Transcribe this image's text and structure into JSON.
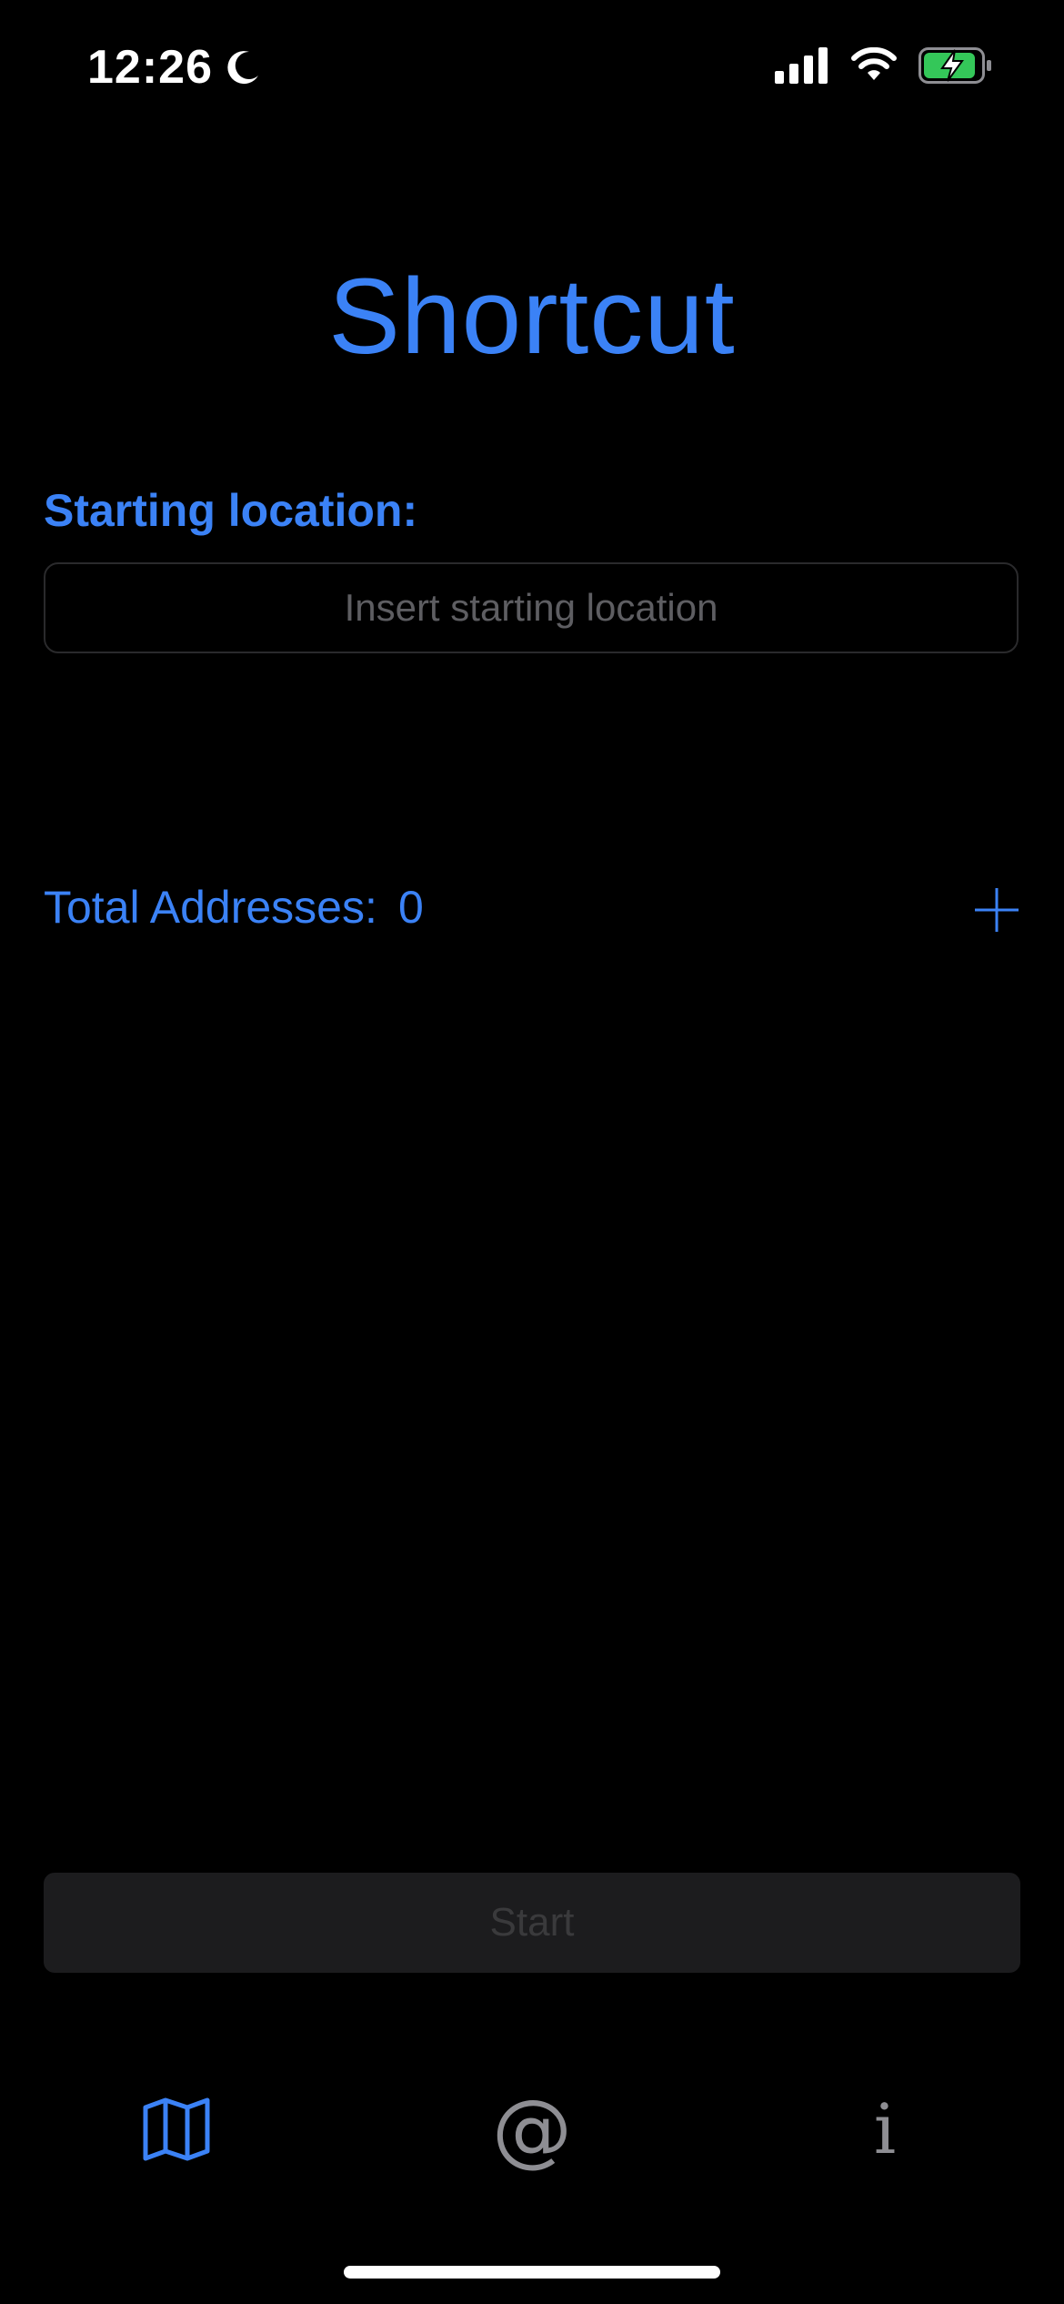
{
  "status_bar": {
    "time": "12:26",
    "icons": [
      "moon-icon",
      "cellular-signal-icon",
      "wifi-icon",
      "battery-charging-icon"
    ],
    "battery_color": "#34c759"
  },
  "app": {
    "title": "Shortcut",
    "accent_color": "#3b82f6"
  },
  "starting_location": {
    "label": "Starting location:",
    "value": "",
    "placeholder": "Insert starting location"
  },
  "addresses": {
    "total_label": "Total Addresses:",
    "count": "0",
    "add_icon": "plus-icon"
  },
  "start_button": {
    "label": "Start",
    "enabled": false
  },
  "tab_bar": {
    "tabs": [
      {
        "icon": "map-icon",
        "selected": true
      },
      {
        "icon": "at-sign-icon",
        "glyph": "@",
        "selected": false
      },
      {
        "icon": "info-icon",
        "glyph": "i",
        "selected": false
      }
    ]
  }
}
